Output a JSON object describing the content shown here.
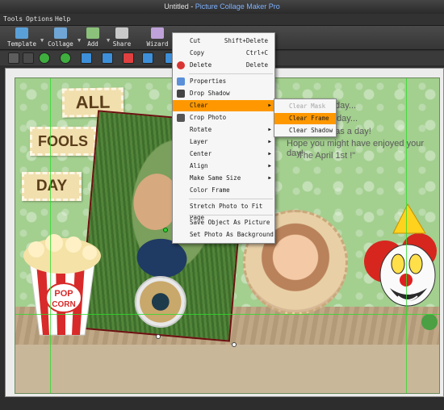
{
  "window": {
    "document": "Untitled",
    "separator": " - ",
    "app_name": "Picture Collage Maker Pro"
  },
  "menu": [
    "Tools",
    "Options",
    "Help"
  ],
  "toolbar": [
    {
      "label": "Template",
      "icon": "template-icon",
      "color": "#5aa0d8"
    },
    {
      "label": "Collage",
      "icon": "collage-icon",
      "color": "#6fa6d6"
    },
    {
      "label": "Add",
      "icon": "add-photo-icon",
      "color": "#8bc17a"
    },
    {
      "label": "Share",
      "icon": "share-icon",
      "color": "#c9c9c9"
    },
    {
      "label": "Wizard",
      "icon": "wizard-icon",
      "color": "#bfa2d9"
    }
  ],
  "canvas": {
    "stamps": [
      "ALL",
      "FOOLS",
      "DAY"
    ],
    "popcorn_text": [
      "POP",
      "CORN"
    ],
    "tagline": [
      "day...",
      "day...",
      "has a day!",
      "Hope you might have enjoyed your day!",
      "The April 1st !\""
    ]
  },
  "context_menu": {
    "items": [
      {
        "label": "Cut",
        "shortcut": "Shift+Delete",
        "icon": "cut-icon"
      },
      {
        "label": "Copy",
        "shortcut": "Ctrl+C",
        "icon": "copy-icon"
      },
      {
        "label": "Delete",
        "shortcut": "Delete",
        "icon": "delete-icon"
      },
      {
        "label": "Properties",
        "shortcut": "",
        "icon": "properties-icon"
      },
      {
        "label": "Drop Shadow",
        "shortcut": "",
        "icon": "drop-shadow-icon"
      },
      {
        "label": "Clear",
        "shortcut": "",
        "icon": ""
      },
      {
        "label": "Crop Photo",
        "shortcut": "",
        "icon": "crop-icon"
      },
      {
        "label": "Rotate",
        "shortcut": "",
        "icon": ""
      },
      {
        "label": "Layer",
        "shortcut": "",
        "icon": ""
      },
      {
        "label": "Center",
        "shortcut": "",
        "icon": ""
      },
      {
        "label": "Align",
        "shortcut": "",
        "icon": ""
      },
      {
        "label": "Make Same Size",
        "shortcut": "",
        "icon": ""
      },
      {
        "label": "Color Frame",
        "shortcut": "",
        "icon": ""
      },
      {
        "label": "Stretch Photo to Fit Page",
        "shortcut": "",
        "icon": ""
      },
      {
        "label": "Save Object As Picture",
        "shortcut": "",
        "icon": ""
      },
      {
        "label": "Set Photo As Background",
        "shortcut": "",
        "icon": ""
      }
    ],
    "highlighted": "Clear"
  },
  "submenu": {
    "items": [
      {
        "label": "Clear Mask",
        "state": "disabled"
      },
      {
        "label": "Clear Frame",
        "state": "highlighted"
      },
      {
        "label": "Clear Shadow",
        "state": "normal"
      }
    ]
  },
  "colors": {
    "highlight": "#ff9800",
    "canvas_bg": "#a3cf8f",
    "guide_line": "#2ddc2d",
    "title_app": "#7fb2ff"
  }
}
